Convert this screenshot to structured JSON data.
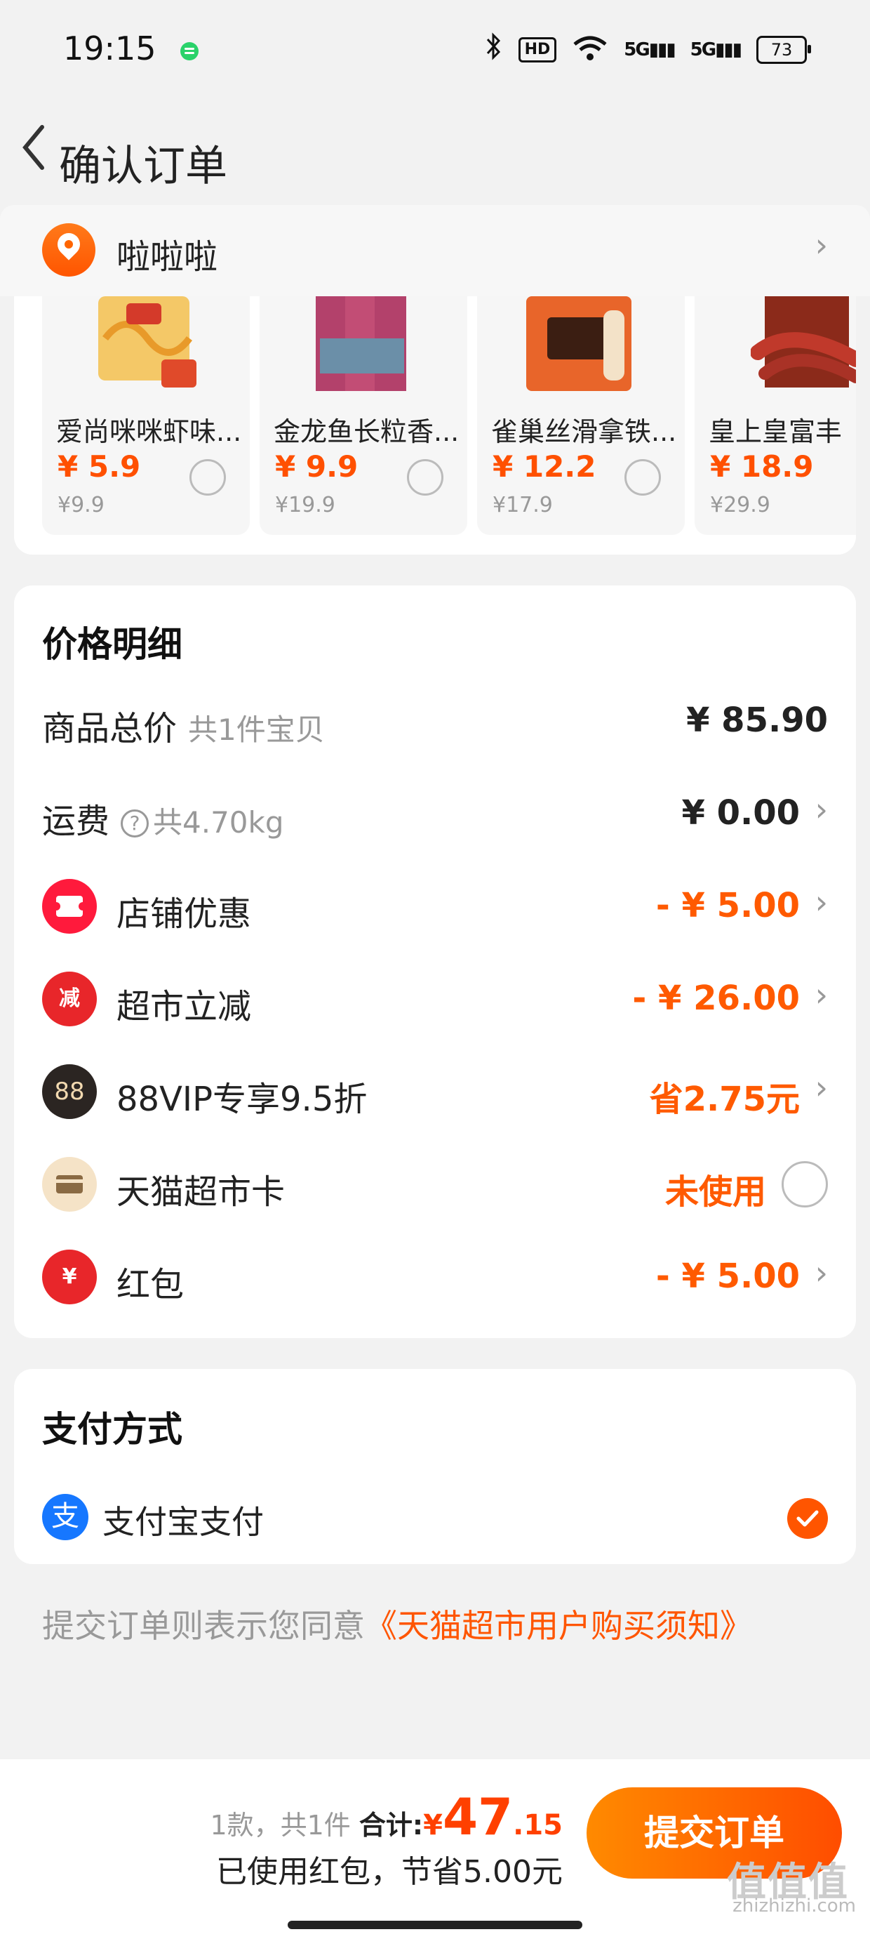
{
  "status_bar": {
    "time": "19:15",
    "battery": "73"
  },
  "nav": {
    "title": "确认订单"
  },
  "address": {
    "name": "啦啦啦"
  },
  "goods": [
    {
      "name": "爱尚咪咪虾味...",
      "price": "¥ 5.9",
      "orig": "¥9.9"
    },
    {
      "name": "金龙鱼长粒香...",
      "price": "¥ 9.9",
      "orig": "¥19.9"
    },
    {
      "name": "雀巢丝滑拿铁...",
      "price": "¥ 12.2",
      "orig": "¥17.9"
    },
    {
      "name": "皇上皇富丰",
      "price": "¥ 18.9",
      "orig": "¥29.9"
    }
  ],
  "price_detail": {
    "title": "价格明细",
    "rows": [
      {
        "label": "商品总价",
        "sub": "共1件宝贝",
        "value": "¥ 85.90"
      },
      {
        "label": "运费",
        "sub": "共4.70kg",
        "value": "¥ 0.00"
      },
      {
        "label": "店铺优惠",
        "value": "- ¥ 5.00"
      },
      {
        "label": "超市立减",
        "value": "- ¥ 26.00"
      },
      {
        "label": "88VIP专享9.5折",
        "value": "省2.75元"
      },
      {
        "label": "天猫超市卡",
        "value": "未使用"
      },
      {
        "label": "红包",
        "value": "- ¥ 5.00"
      }
    ]
  },
  "icons": {
    "coupon_text": "减",
    "vip_text": "88",
    "redpack_text": "¥",
    "alipay_text": "支",
    "help_text": "?"
  },
  "payment": {
    "title": "支付方式",
    "method": "支付宝支付"
  },
  "agreement": {
    "prefix": "提交订单则表示您同意",
    "link": "《天猫超市用户购买须知》"
  },
  "bottom": {
    "count": "1款，共1件",
    "total_label": "合计:",
    "yen": "¥",
    "total_int": "47",
    "total_dec": ".15",
    "saving": "已使用红包，节省5.00元",
    "submit": "提交订单"
  },
  "watermark": {
    "top": "值值值",
    "url": "zhizhizhi.com"
  },
  "colors": {
    "accent": "#ff5500",
    "alipay": "#1677ff"
  }
}
